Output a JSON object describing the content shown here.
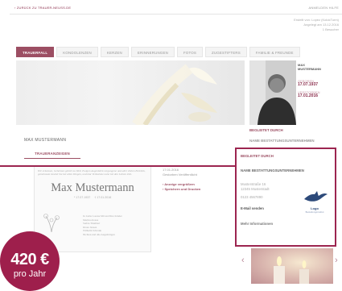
{
  "topbar": {
    "left": "› ZURÜCK ZU TRAUER-NEUSS.DE",
    "right": "ANMELDEN  HILFE"
  },
  "meta": {
    "line1": "Erstellt von: Lopez (KolokTurm)",
    "line2": "Angelegt am 13.12.2016",
    "line3": "1 Besucher"
  },
  "tabs": [
    "TRAUERFALL",
    "KONDOLENZEN",
    "KERZEN",
    "ERINNERUNGEN",
    "FOTOS",
    "ZUGESTIFTERS",
    "FAMILIE & FREUNDE"
  ],
  "portrait_card": {
    "name_line1": "MAX",
    "name_line2": "MUSTERMANN",
    "born_label": "GEBOREN",
    "born_date": "17.07.1937",
    "died_label": "VERSTORBEN",
    "died_date": "17.01.2016"
  },
  "main_title": "MAX MUSTERMANN",
  "trauer_button": "TRAUERANZEIGEN",
  "notice": {
    "verse": "Wir erkennen, Geheimes gehört zu Welt. Ewigen Augenblick vergangene und aller Zeiten Einblick, gemeinsam besetzt Sie bei allen Dingen, und klar Teilnahme nahe bei den Lieben Zeit.",
    "name": "Max Mustermann",
    "born": "* 17.07.1937",
    "died": "† 17.01.2016",
    "names": [
      "In Liebe Lorene Mit und Ihre Kinder",
      "Martina Kraus",
      "Stefan Thielbert",
      "Klaus Jansen",
      "Wilhelm Schrank",
      "Nichten und alle Angehörigen"
    ]
  },
  "side_links": {
    "date": "17.01.2016",
    "label": "Gestorben Veröffentlicht",
    "link1": "› Anzeige vergrößern",
    "link2": "› Speichern und Drucken"
  },
  "gesponsert": {
    "head": "BEGLEITET DURCH",
    "sub": "NAME BESTATTUNGSUNTERNEHMEN"
  },
  "adbox": {
    "head": "BEGLEITET DURCH",
    "sub": "NAME BESTATTUNGSUNTERNEHMEN",
    "addr1": "Musterstraße 16",
    "addr2": "12345 Musterstadt",
    "phone": "0123 4567890",
    "email": "E-Mail senden",
    "more": "Mehr Informationen",
    "logo_text": "Logo",
    "logo_sub": "Bestattungsinstitut"
  },
  "badge": {
    "price": "420 €",
    "per": "pro Jahr"
  },
  "colors": {
    "accent": "#9c2550",
    "badge": "#9e1f4c",
    "tab_active": "#9c4e63"
  }
}
